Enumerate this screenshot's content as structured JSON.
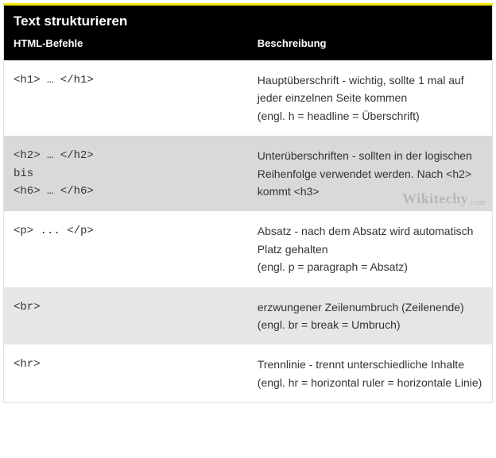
{
  "title": "Text strukturieren",
  "columns": {
    "left": "HTML-Befehle",
    "right": "Beschreibung"
  },
  "rows": [
    {
      "code": "<h1> … </h1>",
      "desc": "Hauptüberschrift - wichtig, sollte 1 mal auf jeder einzelnen Seite kommen\n(engl. h = headline = Überschrift)"
    },
    {
      "code": "<h2> … </h2>\nbis\n<h6> … </h6>",
      "desc": "Unterüberschriften - sollten in der logischen Reihenfolge verwendet werden. Nach <h2> kommt <h3>"
    },
    {
      "code": "<p> ... </p>",
      "desc": "Absatz - nach dem Absatz wird automatisch Platz gehalten\n(engl. p = paragraph = Absatz)"
    },
    {
      "code": "<br>",
      "desc": "erzwungener Zeilenumbruch (Zeilenende)\n(engl. br = break = Umbruch)"
    },
    {
      "code": "<hr>",
      "desc": "Trennlinie - trennt unterschiedliche Inhalte\n(engl. hr = horizontal ruler = horizontale Linie)"
    }
  ],
  "watermark": "Wikitechy",
  "watermark_suffix": ".com"
}
